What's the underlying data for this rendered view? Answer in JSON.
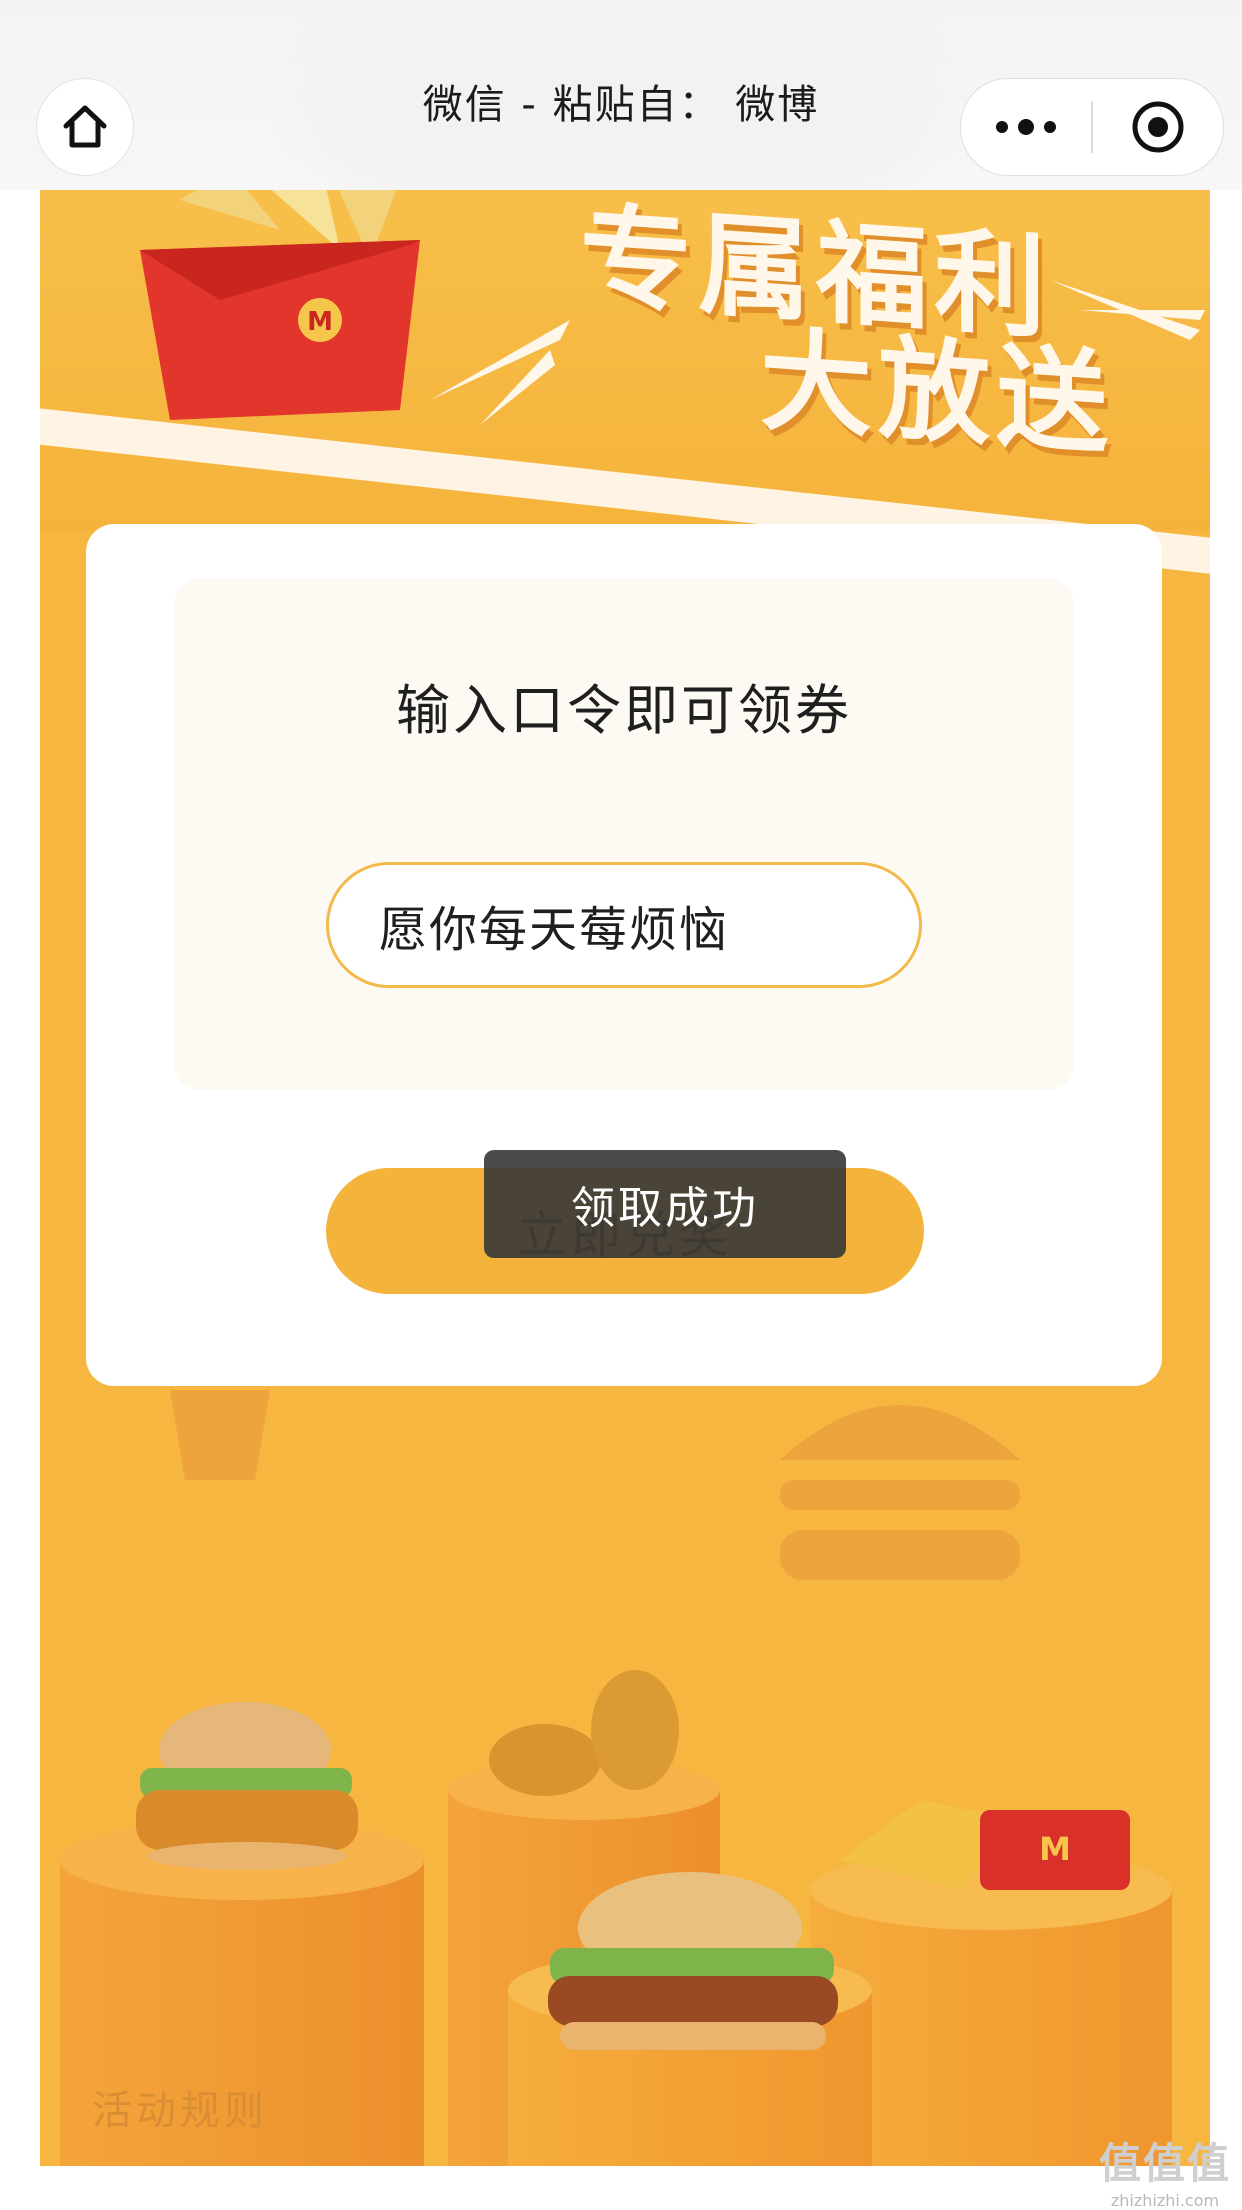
{
  "header": {
    "title": "微信 - 粘贴自： 微博",
    "home_icon": "home-icon",
    "more_icon": "more-dots-icon",
    "close_icon": "target-close-icon"
  },
  "banner": {
    "line1": "专属福利",
    "line2": "大放送"
  },
  "form": {
    "heading": "输入口令即可领券",
    "code_value": "愿你每天莓烦恼",
    "submit_label": "立即兑奖"
  },
  "toast": {
    "message": "领取成功"
  },
  "footer": {
    "rules_label": "活动规则"
  },
  "watermark": {
    "logo": "值值值",
    "site": "zhizhizhi.com"
  },
  "colors": {
    "page_bg": "#f6b640",
    "button": "#f4b43c",
    "input_border": "#f2ba4c",
    "toast_bg": "#373737"
  }
}
